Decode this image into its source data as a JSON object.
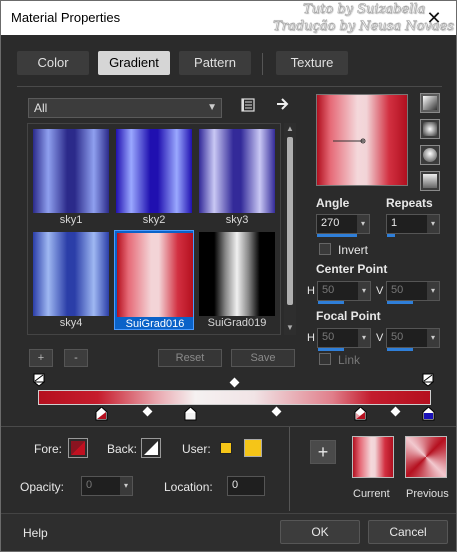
{
  "window": {
    "title": "Material Properties",
    "close_glyph": "✕"
  },
  "watermark": {
    "line1": "Tuto by  Suizabella",
    "line2": "Tradução by  Neusa Novaes"
  },
  "tabs": [
    {
      "label": "Color",
      "active": false
    },
    {
      "label": "Gradient",
      "active": true
    },
    {
      "label": "Pattern",
      "active": false
    },
    {
      "label": "Texture",
      "active": false
    }
  ],
  "category": {
    "value": "All"
  },
  "gallery": {
    "items": [
      {
        "label": "sky1",
        "colors": [
          "#2b2a8a",
          "#8fa0ef"
        ]
      },
      {
        "label": "sky2",
        "colors": [
          "#2010b0",
          "#9aa8ff"
        ]
      },
      {
        "label": "sky3",
        "colors": [
          "#332a99",
          "#c9c8f4"
        ]
      },
      {
        "label": "sky4",
        "colors": [
          "#2b3ea8",
          "#9fb8f2"
        ]
      },
      {
        "label": "SuiGrad016",
        "colors": [
          "#b4101f",
          "#f3d4d7"
        ],
        "selected": true
      },
      {
        "label": "SuiGrad019",
        "colors": [
          "#000000",
          "#f0f0f0"
        ]
      }
    ]
  },
  "gallery_buttons": {
    "add": "+",
    "remove": "-",
    "reset": "Reset",
    "save": "Save"
  },
  "angle": {
    "label": "Angle",
    "value": "270"
  },
  "repeats": {
    "label": "Repeats",
    "value": "1"
  },
  "invert": {
    "label": "Invert",
    "checked": false
  },
  "center_point": {
    "label": "Center Point",
    "h_label": "H",
    "h_value": "50",
    "v_label": "V",
    "v_value": "50"
  },
  "focal_point": {
    "label": "Focal Point",
    "h_label": "H",
    "h_value": "50",
    "v_label": "V",
    "v_value": "50"
  },
  "link": {
    "label": "Link",
    "checked": false
  },
  "stops": {
    "fore_label": "Fore:",
    "back_label": "Back:",
    "user_label": "User:",
    "user_color": "#f5c518",
    "opacity_label": "Opacity:",
    "opacity_value": "0",
    "location_label": "Location:",
    "location_value": "0"
  },
  "preview": {
    "add_button": "+",
    "current_label": "Current",
    "previous_label": "Previous"
  },
  "footer": {
    "help": "Help",
    "ok": "OK",
    "cancel": "Cancel"
  },
  "colors": {
    "accent": "#0a62c8",
    "gradient_red": "#b5101f",
    "gradient_light": "#f5f1f1"
  }
}
